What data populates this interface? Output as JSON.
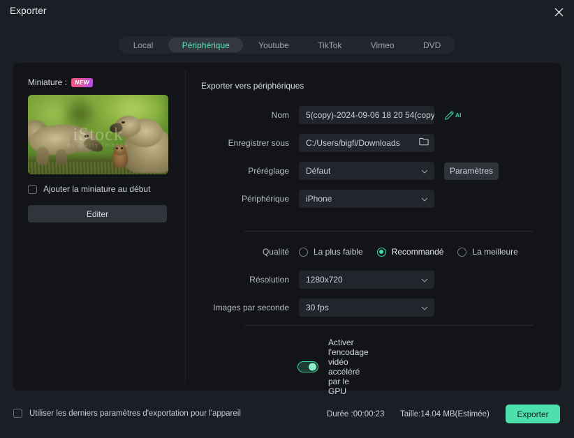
{
  "window": {
    "title": "Exporter",
    "close_icon": "close-icon"
  },
  "tabs": [
    {
      "label": "Local",
      "active": false
    },
    {
      "label": "Périphérique",
      "active": true
    },
    {
      "label": "Youtube",
      "active": false
    },
    {
      "label": "TikTok",
      "active": false
    },
    {
      "label": "Vimeo",
      "active": false
    },
    {
      "label": "DVD",
      "active": false
    }
  ],
  "thumbnail_panel": {
    "label": "Miniature :",
    "badge": "NEW",
    "image_watermark": "iStock",
    "image_watermark_sub": "by Getty Images",
    "checkbox_label": "Ajouter la miniature au début",
    "checkbox_checked": false,
    "edit_button": "Editer"
  },
  "form": {
    "section_title": "Exporter vers périphériques",
    "name": {
      "label": "Nom",
      "value": "5(copy)-2024-09-06 18 20 54(copy)",
      "ai_icon": "ai-pencil-icon",
      "ai_text": "AI"
    },
    "save_to": {
      "label": "Enregistrer sous",
      "value": "C:/Users/bigfi/Downloads",
      "folder_icon": "folder-icon"
    },
    "preset": {
      "label": "Préréglage",
      "value": "Défaut",
      "settings_button": "Paramètres"
    },
    "device": {
      "label": "Périphérique",
      "value": "iPhone"
    },
    "quality": {
      "label": "Qualité",
      "options": [
        {
          "label": "La plus faible",
          "selected": false
        },
        {
          "label": "Recommandé",
          "selected": true
        },
        {
          "label": "La meilleure",
          "selected": false
        }
      ]
    },
    "resolution": {
      "label": "Résolution",
      "value": "1280x720"
    },
    "framerate": {
      "label": "Images par seconde",
      "value": "30 fps"
    },
    "gpu": {
      "label": "Activer l'encodage vidéo accéléré par le GPU",
      "enabled": true
    }
  },
  "footer": {
    "checkbox_label": "Utiliser les derniers paramètres d'exportation pour l'appareil",
    "checkbox_checked": false,
    "duration": "Durée :00:00:23",
    "size": "Taille:14.04 MB(Estimée)",
    "export_button": "Exporter"
  },
  "colors": {
    "accent": "#4ee0ac",
    "accent_text": "#55e3b0",
    "dialog_bg": "#1b1e25",
    "panel_bg": "#121418",
    "field_bg": "#22252b"
  }
}
